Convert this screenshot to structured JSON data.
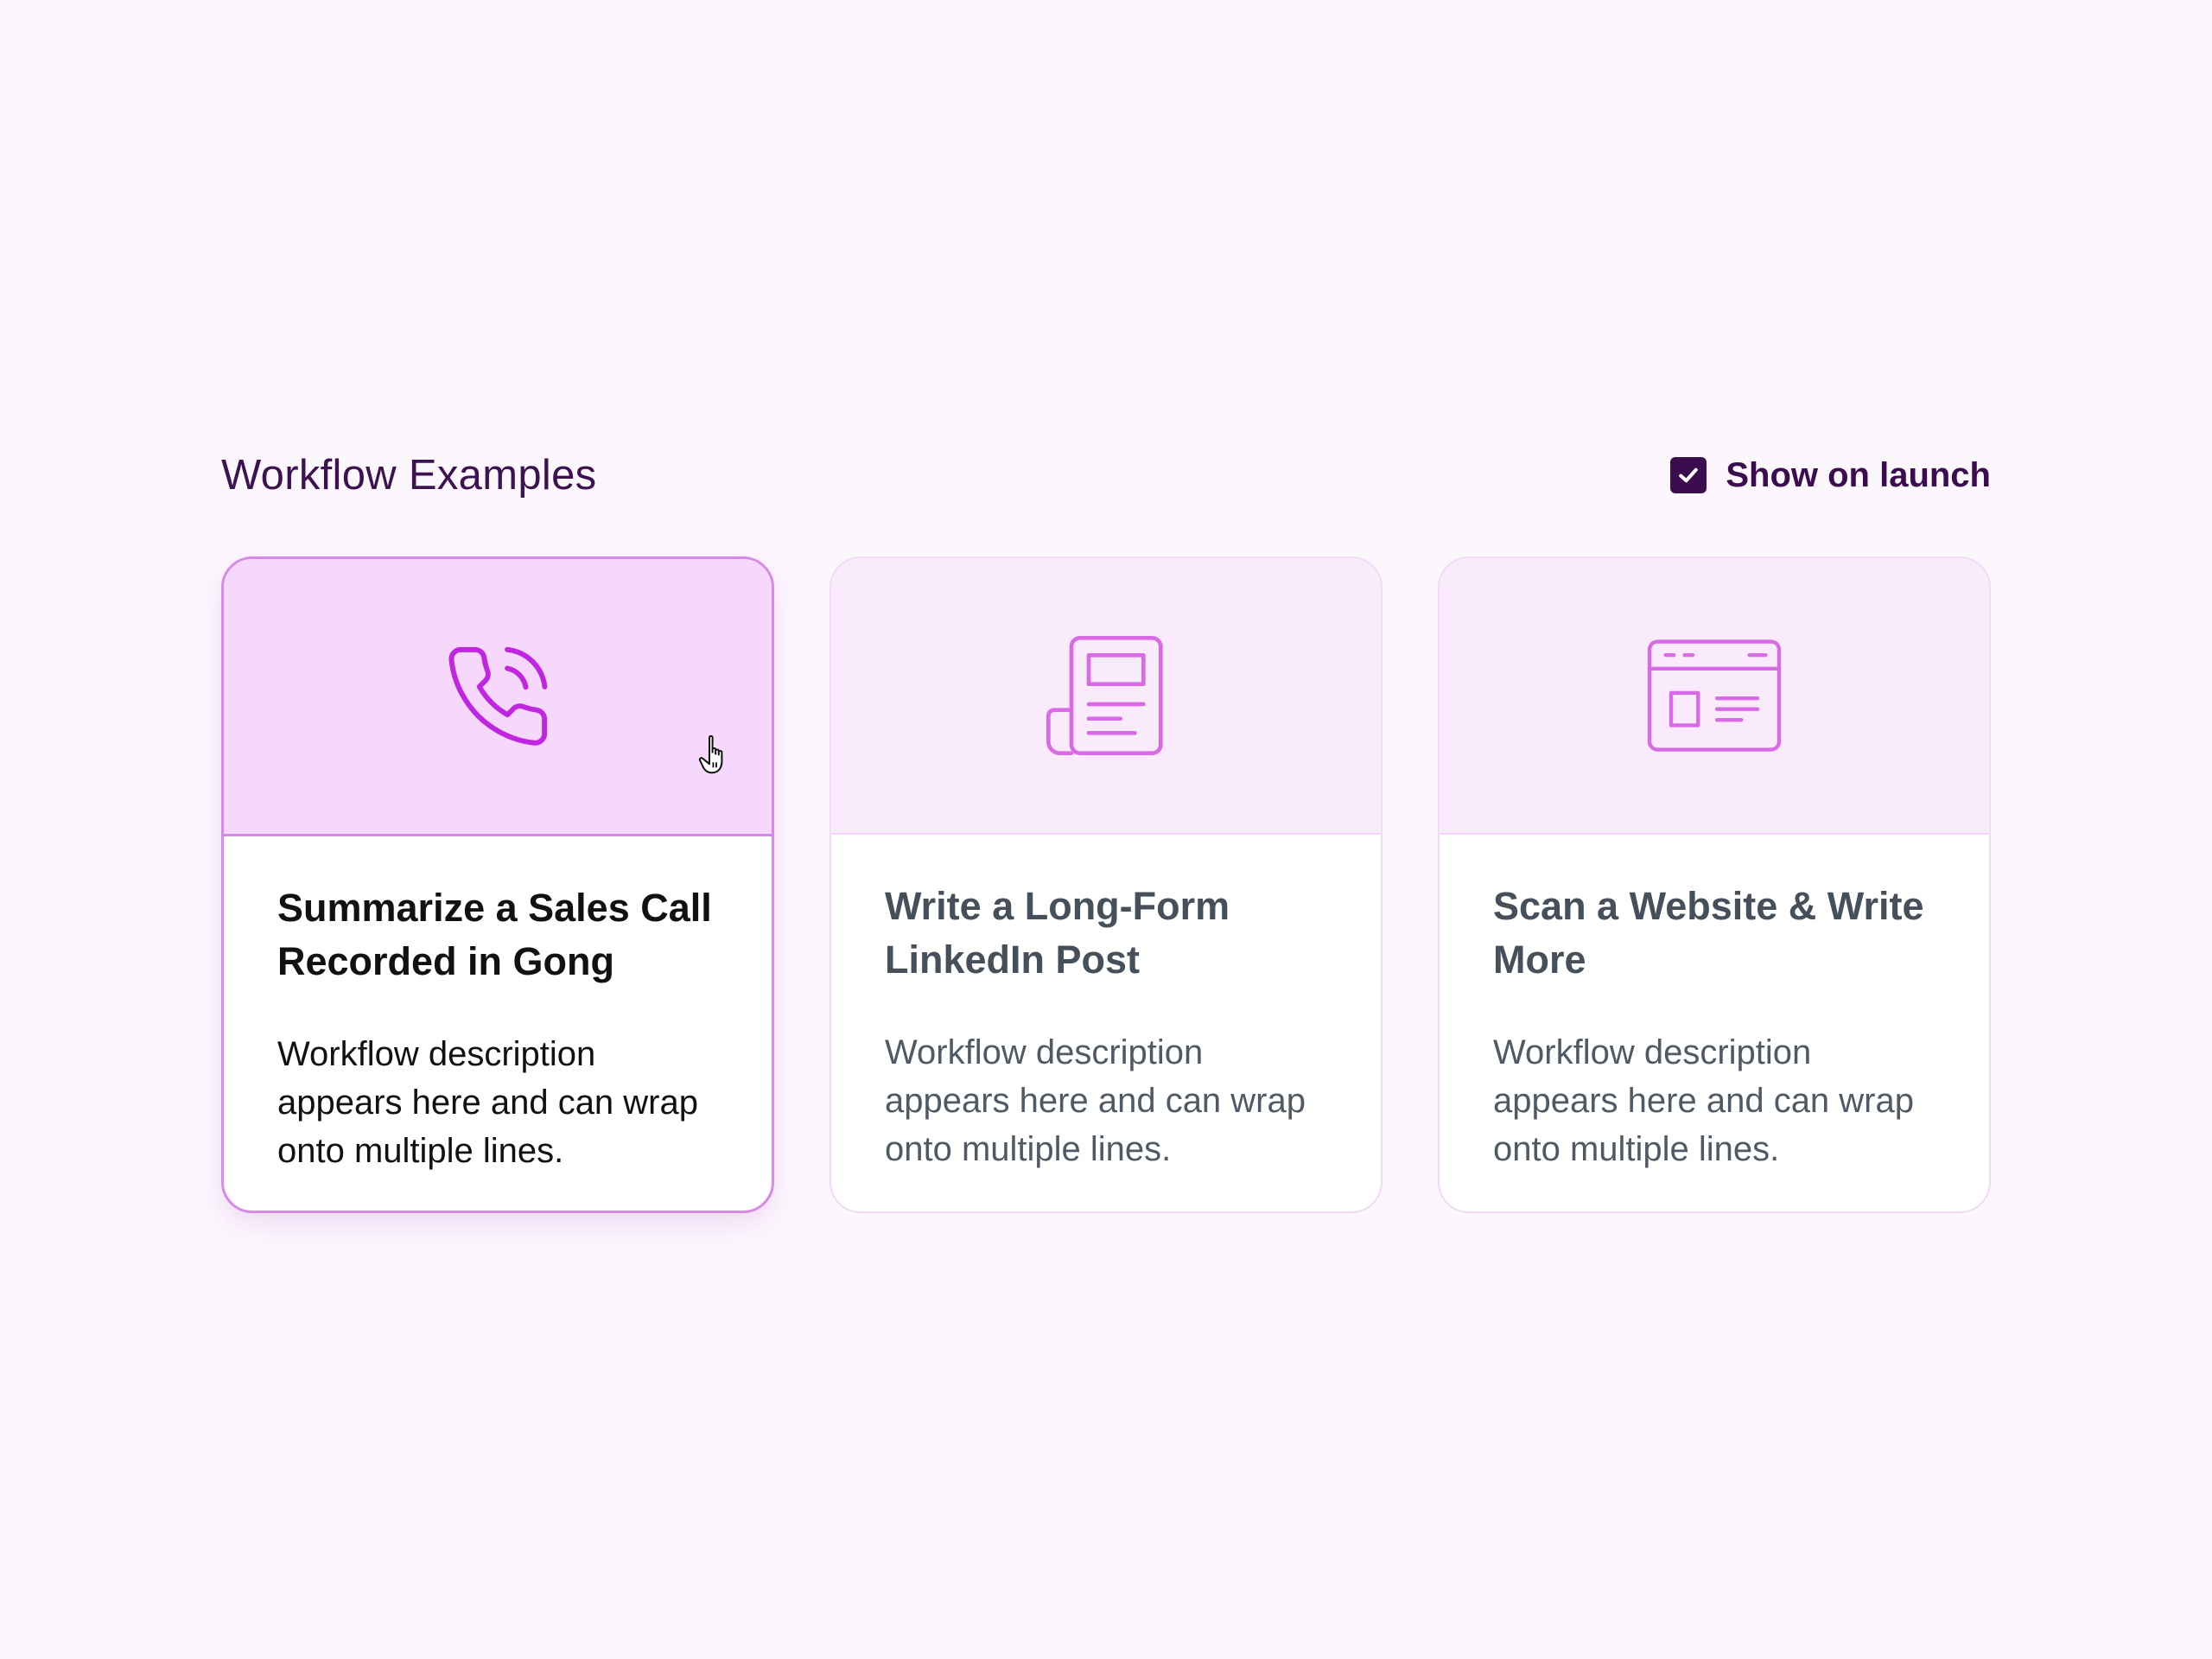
{
  "header": {
    "title": "Workflow Examples",
    "show_on_launch": {
      "label": "Show on launch",
      "checked": true
    }
  },
  "cards": [
    {
      "icon": "phone-call-icon",
      "title": "Summarize a Sales Call Recorded in Gong",
      "description": "Workflow description appears here and can wrap onto multiple lines.",
      "state": "hovered"
    },
    {
      "icon": "newspaper-icon",
      "title": "Write a Long-Form LinkedIn Post",
      "description": "Workflow description appears here and can wrap onto multiple lines."
    },
    {
      "icon": "browser-window-icon",
      "title": "Scan a Website & Write More",
      "description": "Workflow description appears here and can wrap onto multiple lines."
    }
  ],
  "colors": {
    "background": "#fcf6fd",
    "accent": "#c026e0",
    "icon_muted": "#d96ae6",
    "dark_purple": "#3b0d4f",
    "card_border_active": "#d88ae8"
  }
}
